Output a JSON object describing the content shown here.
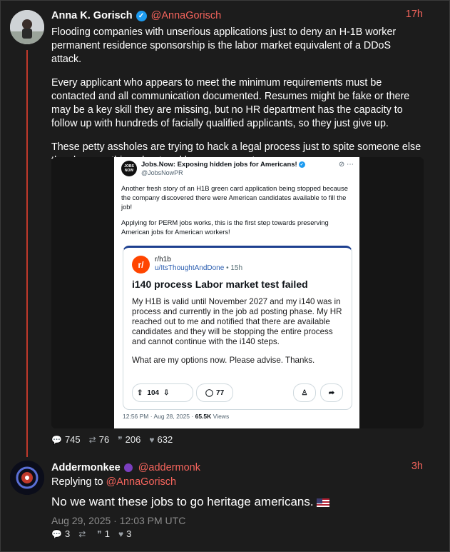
{
  "post1": {
    "name": "Anna K. Gorisch",
    "handle": "@AnnaGorisch",
    "time": "17h",
    "paragraphs": [
      "Flooding companies with unserious applications just to deny an H-1B worker permanent residence sponsorship is the labor market equivalent of a DDoS attack.",
      "Every applicant who appears to meet the minimum requirements must be contacted and all communication documented. Resumes might be fake or there may be a key skill they are missing, but no HR department has the capacity to follow up with hundreds of facially qualified applicants, so they just give up.",
      "These petty assholes are trying to hack a legal process just to spite someone else they know nothing about and have never met."
    ],
    "stats": {
      "comments": "745",
      "retweets": "76",
      "quotes": "206",
      "likes": "632"
    }
  },
  "embedded": {
    "avatar_text": "JOBS NOW",
    "name": "Jobs.Now: Exposing hidden jobs for Americans!",
    "handle": "@JobsNowPR",
    "paragraphs": [
      "Another fresh story of an H1B green card application being stopped because the company discovered there were American candidates available to fill the job!",
      "Applying for PERM jobs works, this is the first step towards preserving American jobs for American workers!"
    ],
    "reddit": {
      "subreddit": "r/h1b",
      "user": "u/ItsThoughtAndDone",
      "age": "15h",
      "title": "i140 process Labor market test failed",
      "body": [
        "My H1B is valid until November 2027 and my i140 was in process and currently in the job ad posting phase. My HR reached out to me and notified that there are available candidates and they will be stopping the entire process and cannot continue with the i140 steps.",
        "What are my options now. Please advise. Thanks."
      ],
      "upvotes": "104",
      "comments": "77"
    },
    "meta_time": "12:56 PM · Aug 28, 2025 ·",
    "views": "65.5K",
    "views_label": "Views"
  },
  "post2": {
    "name": "Addermonkee",
    "handle": "@addermonk",
    "time": "3h",
    "replying_label": "Replying to",
    "replying_handle": "@AnnaGorisch",
    "text": "No we want these jobs to go heritage americans.",
    "timestamp": "Aug 29, 2025 · 12:03 PM UTC",
    "stats": {
      "comments": "3",
      "retweets": "",
      "quotes": "1",
      "likes": "3"
    }
  },
  "colors": {
    "accent": "#f4645c",
    "thread": "#c0392b",
    "verified": "#1d9bf0",
    "background": "#1c1c1c"
  },
  "icons": [
    "verified-badge-icon",
    "comment-icon",
    "retweet-icon",
    "quote-icon",
    "heart-icon",
    "upvote-icon",
    "downvote-icon",
    "share-icon",
    "award-icon",
    "more-icon"
  ]
}
